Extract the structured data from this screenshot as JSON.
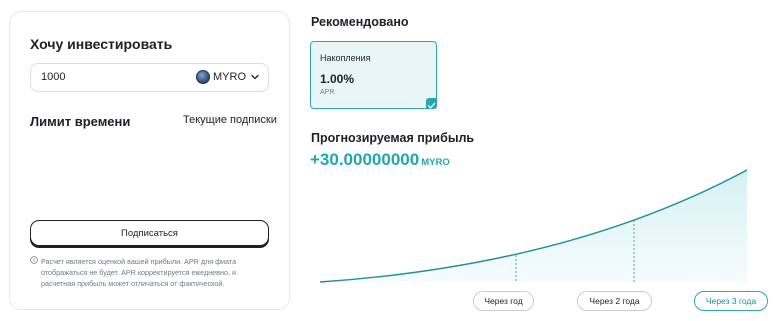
{
  "invest": {
    "title": "Хочу инвестировать",
    "amount": "1000",
    "coin": "MYRO",
    "coin_icon": "myro-coin-icon"
  },
  "time_limit": {
    "title": "Лимит времени",
    "current_subscriptions": "Текущие подписки"
  },
  "subscribe_label": "Подписаться",
  "disclaimer": "Расчет является оценкой вашей прибыли. APR для фиата отображаться не будет. APR корректируется ежедневно, и расчетная прибыль может отличаться от фактической.",
  "recommended": {
    "title": "Рекомендовано",
    "product": {
      "name": "Накопления",
      "apr": "1.00%",
      "apr_label": "APR",
      "selected": true
    }
  },
  "profit": {
    "title": "Прогнозируемая прибыль",
    "value": "+30.00000000",
    "coin": "MYRO"
  },
  "periods": [
    {
      "label": "Через год",
      "active": false
    },
    {
      "label": "Через 2 года",
      "active": false
    },
    {
      "label": "Через 3 года",
      "active": true
    }
  ],
  "colors": {
    "accent": "#1ea7b0",
    "accent_border": "#2aa6b4",
    "card_bg": "#e8f6f8",
    "text": "#1e2026",
    "muted": "#707a8a"
  }
}
